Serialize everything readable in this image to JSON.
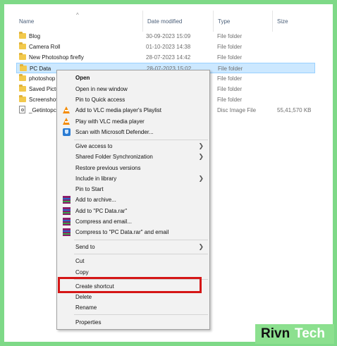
{
  "columns": {
    "name": "Name",
    "date": "Date modified",
    "type": "Type",
    "size": "Size"
  },
  "files": [
    {
      "name": "Blog",
      "date": "30-09-2023 15:09",
      "type": "File folder",
      "size": "",
      "icon": "folder-icon"
    },
    {
      "name": "Camera Roll",
      "date": "01-10-2023 14:38",
      "type": "File folder",
      "size": "",
      "icon": "folder-icon"
    },
    {
      "name": "New Photoshop firefly",
      "date": "28-07-2023 14:42",
      "type": "File folder",
      "size": "",
      "icon": "folder-icon"
    },
    {
      "name": "PC Data",
      "date": "28-07-2023 15:02",
      "type": "File folder",
      "size": "",
      "icon": "folder-icon",
      "selected": true
    },
    {
      "name": "photoshop",
      "date": "",
      "type": "File folder",
      "size": "",
      "icon": "folder-icon"
    },
    {
      "name": "Saved Pictu",
      "date": "",
      "type": "File folder",
      "size": "",
      "icon": "folder-icon"
    },
    {
      "name": "Screenshots",
      "date": "",
      "type": "File folder",
      "size": "",
      "icon": "folder-icon"
    },
    {
      "name": "_Getintopc.",
      "date": "",
      "type": "Disc Image File",
      "size": "55,41,570 KB",
      "icon": "disc-image-icon"
    }
  ],
  "context_menu": {
    "items": [
      {
        "label": "Open",
        "bold": true
      },
      {
        "label": "Open in new window"
      },
      {
        "label": "Pin to Quick access"
      },
      {
        "label": "Add to VLC media player's Playlist",
        "icon": "vlc-icon"
      },
      {
        "label": "Play with VLC media player",
        "icon": "vlc-icon"
      },
      {
        "label": "Scan with Microsoft Defender...",
        "icon": "defender-icon"
      },
      {
        "label": "Give access to",
        "submenu": true
      },
      {
        "label": "Shared Folder Synchronization",
        "submenu": true
      },
      {
        "label": "Restore previous versions"
      },
      {
        "label": "Include in library",
        "submenu": true
      },
      {
        "label": "Pin to Start"
      },
      {
        "label": "Add to archive...",
        "icon": "winrar-icon"
      },
      {
        "label": "Add to \"PC Data.rar\"",
        "icon": "winrar-icon"
      },
      {
        "label": "Compress and email...",
        "icon": "winrar-icon"
      },
      {
        "label": "Compress to \"PC Data.rar\" and email",
        "icon": "winrar-icon"
      },
      {
        "label": "Send to",
        "submenu": true
      },
      {
        "label": "Cut"
      },
      {
        "label": "Copy"
      },
      {
        "label": "Create shortcut",
        "highlighted": true
      },
      {
        "label": "Delete"
      },
      {
        "label": "Rename"
      },
      {
        "label": "Properties"
      }
    ]
  },
  "watermark": {
    "part1": "Rivn",
    "part2": "Tech"
  },
  "colors": {
    "frame": "#7ed987",
    "highlight_box": "#d51616",
    "selection": "#cce8ff"
  }
}
